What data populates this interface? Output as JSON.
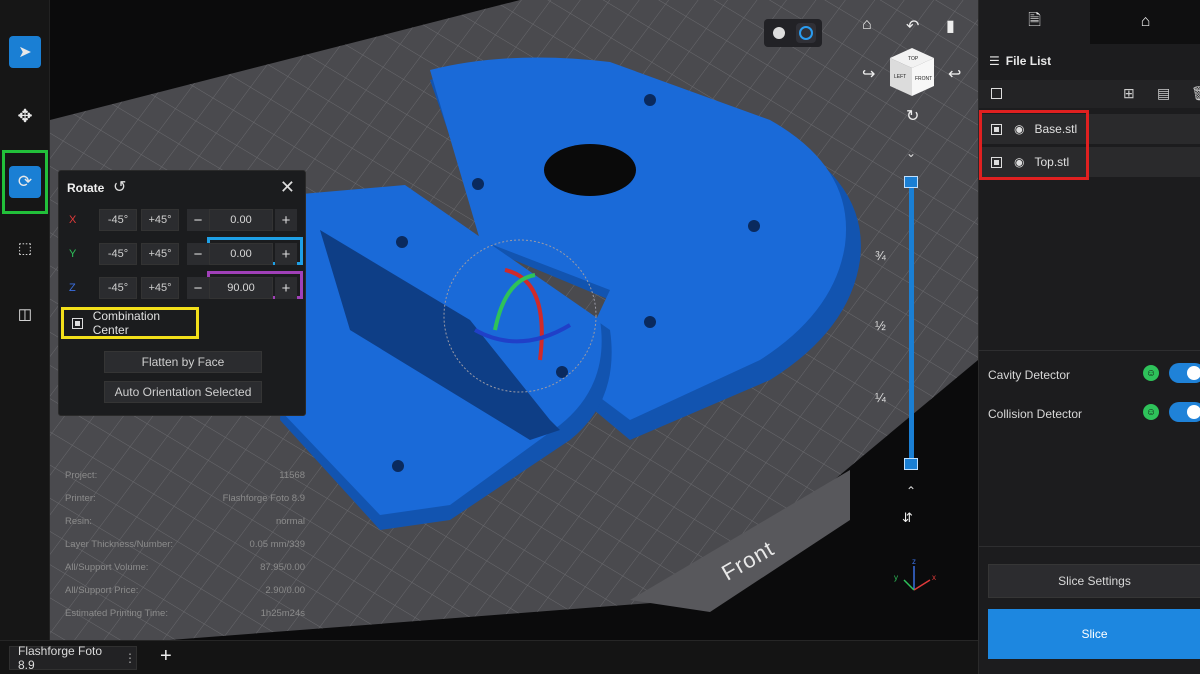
{
  "toolbar": {
    "tools": [
      {
        "name": "select-tool",
        "icon": "cursor-icon"
      },
      {
        "name": "move-tool",
        "icon": "move-arrows-icon"
      },
      {
        "name": "rotate-tool",
        "icon": "rotate-icon",
        "active": true
      },
      {
        "name": "scale-tool",
        "icon": "scale-icon"
      },
      {
        "name": "mirror-tool",
        "icon": "mirror-icon"
      }
    ]
  },
  "rotate_panel": {
    "title": "Rotate",
    "minus45": "-45°",
    "plus45": "+45°",
    "axes": [
      {
        "label": "X",
        "value": "0.00",
        "color": "#e03a3a"
      },
      {
        "label": "Y",
        "value": "0.00",
        "color": "#2ec25a"
      },
      {
        "label": "Z",
        "value": "90.00",
        "color": "#3a6ee0"
      }
    ],
    "combination_center": "Combination Center",
    "flatten_by_face": "Flatten by Face",
    "auto_orientation": "Auto Orientation Selected"
  },
  "project_info": [
    {
      "key": "Project:",
      "value": "11568"
    },
    {
      "key": "Printer:",
      "value": "Flashforge Foto 8.9"
    },
    {
      "key": "Resin:",
      "value": "normal"
    },
    {
      "key": "Layer Thickness/Number:",
      "value": "0.05 mm/339"
    },
    {
      "key": "All/Support Volume:",
      "value": "87.95/0.00"
    },
    {
      "key": "All/Support Price:",
      "value": "2.90/0.00"
    },
    {
      "key": "Estimated Printing Time:",
      "value": "1h25m24s"
    }
  ],
  "right_panel": {
    "file_list_title": "File List",
    "files": [
      "Base.stl",
      "Top.stl"
    ],
    "cavity_detector": "Cavity Detector",
    "collision_detector": "Collision Detector",
    "slice_settings": "Slice Settings",
    "slice": "Slice"
  },
  "viewport": {
    "cube_faces": {
      "top": "TOP",
      "left": "LEFT",
      "front": "FRONT"
    },
    "slider_labels": [
      "¾",
      "½",
      "¼"
    ],
    "front_label": "Front",
    "axis_labels": {
      "x": "x",
      "y": "y",
      "z": "z"
    }
  },
  "bottom_bar": {
    "printer_tab": "Flashforge Foto 8.9"
  },
  "colors": {
    "accent": "#1a7fd4",
    "model_blue": "#1560c8",
    "highlight_green": "#22c03a",
    "highlight_blue": "#1ea0e6",
    "highlight_purple": "#a040b8",
    "highlight_yellow": "#f2df1a",
    "highlight_red": "#e02020"
  }
}
